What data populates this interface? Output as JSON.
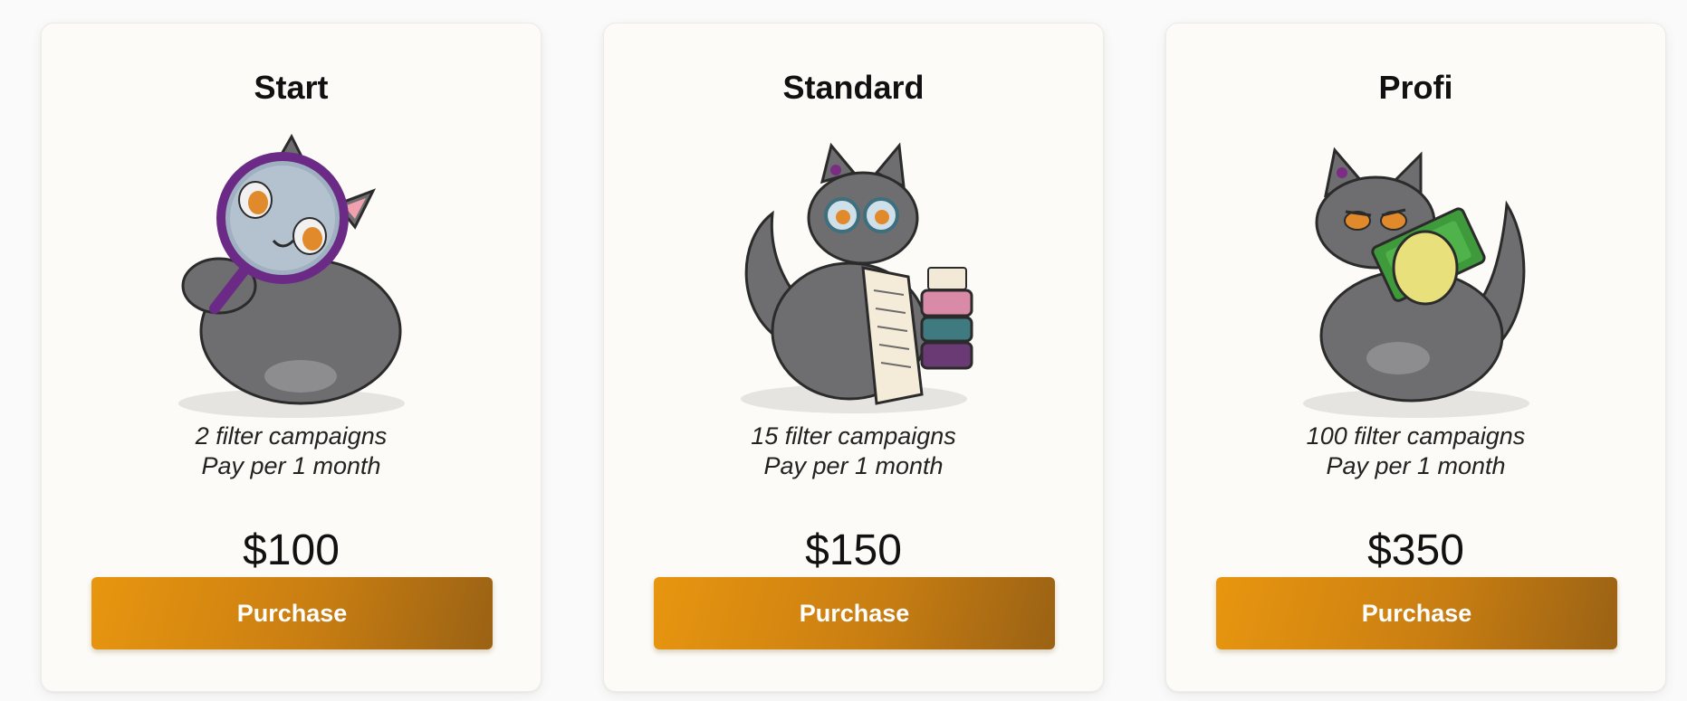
{
  "plans": [
    {
      "name": "Start",
      "illustration_icon": "cat-with-magnifying-glass-icon",
      "campaigns": "2 filter campaigns",
      "period": "Pay per 1 month",
      "price": "$100",
      "button_label": "Purchase"
    },
    {
      "name": "Standard",
      "illustration_icon": "cat-with-glasses-and-books-icon",
      "campaigns": "15 filter campaigns",
      "period": "Pay per 1 month",
      "price": "$150",
      "button_label": "Purchase"
    },
    {
      "name": "Profi",
      "illustration_icon": "cat-with-money-icon",
      "campaigns": "100 filter campaigns",
      "period": "Pay per 1 month",
      "price": "$350",
      "button_label": "Purchase"
    }
  ],
  "colors": {
    "button_start": "#e8960f",
    "button_end": "#9a6214",
    "card_background": "#fcfbf7",
    "cat_body": "#6b6b6b"
  }
}
